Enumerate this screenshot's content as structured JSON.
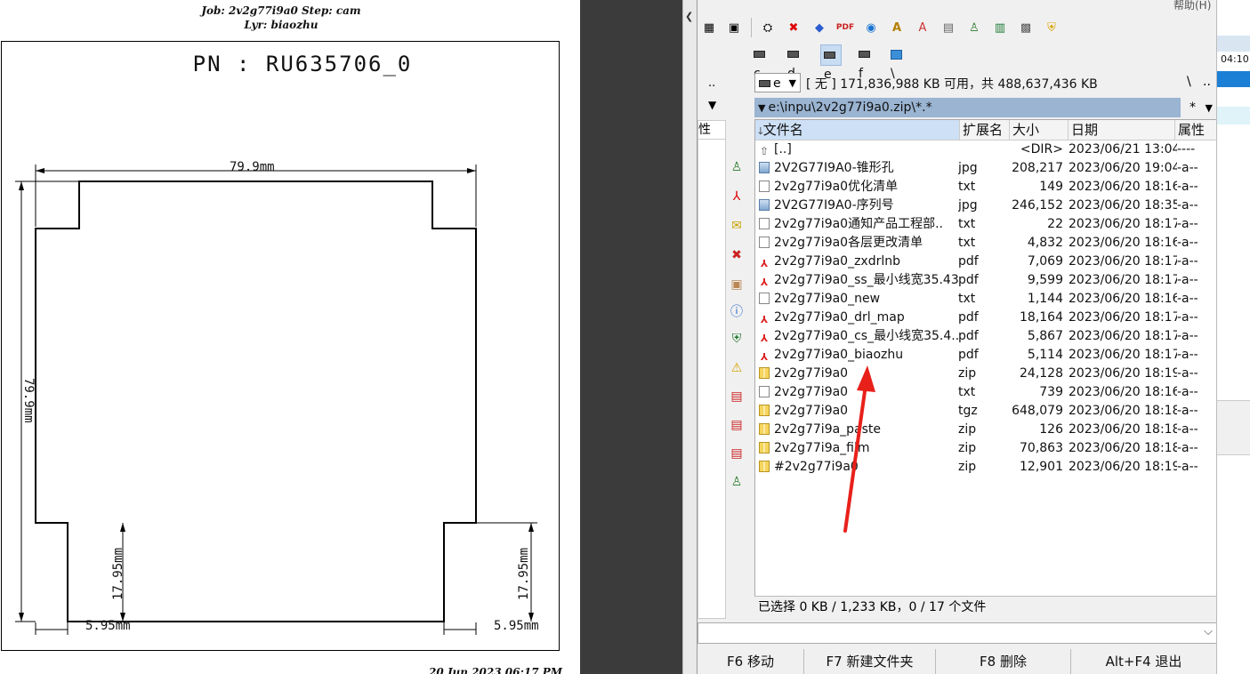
{
  "document": {
    "header_line1": "Job: 2v2g77i9a0  Step: cam",
    "header_line2": "Lyr: biaozhu",
    "pn_text": "PN  :  RU635706_0",
    "dims": {
      "top_width": "79.9mm",
      "left_height": "79.9mm",
      "bottom_left_height": "17.95mm",
      "bottom_right_height": "17.95mm",
      "bottom_left_width": "5.95mm",
      "bottom_right_width": "5.95mm"
    },
    "footer": "20 Jun 2023 06:17 PM"
  },
  "file_manager": {
    "menu_help": "帮助(H)",
    "toolbar_icons": [
      "tree-icon",
      "pack-icon",
      "net-icon",
      "delete-icon",
      "cube-icon",
      "pdf-icon",
      "sync-icon",
      "font-icon",
      "font2-icon",
      "doc-icon",
      "user-icon",
      "excel-icon",
      "settings-icon",
      "shield-icon"
    ],
    "drives": [
      {
        "label": "c",
        "selected": false
      },
      {
        "label": "d",
        "selected": false
      },
      {
        "label": "e",
        "selected": true
      },
      {
        "label": "f",
        "selected": false
      },
      {
        "label": "\\",
        "selected": false
      }
    ],
    "left_col_header": "性",
    "left_col_top": "..",
    "drive_select": "e",
    "free_info": "[ 无 ]  171,836,988 KB 可用，共 488,637,436 KB",
    "root_btn": "\\",
    "up_btn": "..",
    "current_path": "e:\\inpu\\2v2g77i9a0.zip\\*.*",
    "filter": "*",
    "columns": {
      "name": "文件名",
      "ext": "扩展名",
      "size": "大小",
      "date": "日期",
      "attr": "属性"
    },
    "files": [
      {
        "name": "[..]",
        "ext": "",
        "size": "<DIR>",
        "date": "2023/06/21 13:04",
        "attr": "----",
        "icon": "up"
      },
      {
        "name": "2V2G77I9A0-锥形孔",
        "ext": "jpg",
        "size": "208,217",
        "date": "2023/06/20 19:04",
        "attr": "-a--",
        "icon": "img"
      },
      {
        "name": "2v2g77i9a0优化清单",
        "ext": "txt",
        "size": "149",
        "date": "2023/06/20 18:16",
        "attr": "-a--",
        "icon": "txt"
      },
      {
        "name": "2V2G77I9A0-序列号",
        "ext": "jpg",
        "size": "246,152",
        "date": "2023/06/20 18:35",
        "attr": "-a--",
        "icon": "img"
      },
      {
        "name": "2v2g77i9a0通知产品工程部..",
        "ext": "txt",
        "size": "22",
        "date": "2023/06/20 18:17",
        "attr": "-a--",
        "icon": "txt"
      },
      {
        "name": "2v2g77i9a0各层更改清单",
        "ext": "txt",
        "size": "4,832",
        "date": "2023/06/20 18:16",
        "attr": "-a--",
        "icon": "txt"
      },
      {
        "name": "2v2g77i9a0_zxdrlnb",
        "ext": "pdf",
        "size": "7,069",
        "date": "2023/06/20 18:17",
        "attr": "-a--",
        "icon": "pdf"
      },
      {
        "name": "2v2g77i9a0_ss_最小线宽35.43..",
        "ext": "pdf",
        "size": "9,599",
        "date": "2023/06/20 18:17",
        "attr": "-a--",
        "icon": "pdf"
      },
      {
        "name": "2v2g77i9a0_new",
        "ext": "txt",
        "size": "1,144",
        "date": "2023/06/20 18:16",
        "attr": "-a--",
        "icon": "txt"
      },
      {
        "name": "2v2g77i9a0_drl_map",
        "ext": "pdf",
        "size": "18,164",
        "date": "2023/06/20 18:17",
        "attr": "-a--",
        "icon": "pdf"
      },
      {
        "name": "2v2g77i9a0_cs_最小线宽35.4..",
        "ext": "pdf",
        "size": "5,867",
        "date": "2023/06/20 18:17",
        "attr": "-a--",
        "icon": "pdf"
      },
      {
        "name": "2v2g77i9a0_biaozhu",
        "ext": "pdf",
        "size": "5,114",
        "date": "2023/06/20 18:17",
        "attr": "-a--",
        "icon": "pdf"
      },
      {
        "name": "2v2g77i9a0",
        "ext": "zip",
        "size": "24,128",
        "date": "2023/06/20 18:19",
        "attr": "-a--",
        "icon": "zip"
      },
      {
        "name": "2v2g77i9a0",
        "ext": "txt",
        "size": "739",
        "date": "2023/06/20 18:16",
        "attr": "-a--",
        "icon": "txt"
      },
      {
        "name": "2v2g77i9a0",
        "ext": "tgz",
        "size": "648,079",
        "date": "2023/06/20 18:18",
        "attr": "-a--",
        "icon": "zip"
      },
      {
        "name": "2v2g77i9a_paste",
        "ext": "zip",
        "size": "126",
        "date": "2023/06/20 18:18",
        "attr": "-a--",
        "icon": "zip"
      },
      {
        "name": "2v2g77i9a_film",
        "ext": "zip",
        "size": "70,863",
        "date": "2023/06/20 18:18",
        "attr": "-a--",
        "icon": "zip"
      },
      {
        "name": "#2v2g77i9a0",
        "ext": "zip",
        "size": "12,901",
        "date": "2023/06/20 18:19",
        "attr": "-a--",
        "icon": "zip"
      }
    ],
    "status": "已选择 0 KB / 1,233 KB，0 / 17 个文件",
    "fkeys": [
      "F6 移动",
      "F7 新建文件夹",
      "F8 删除",
      "Alt+F4 退出"
    ]
  },
  "far_window": {
    "time": "04:10"
  },
  "colors": {
    "arrow": "#e8201a",
    "path_bar": "#9ab4d2",
    "selection_blue": "#1b7fd6"
  }
}
